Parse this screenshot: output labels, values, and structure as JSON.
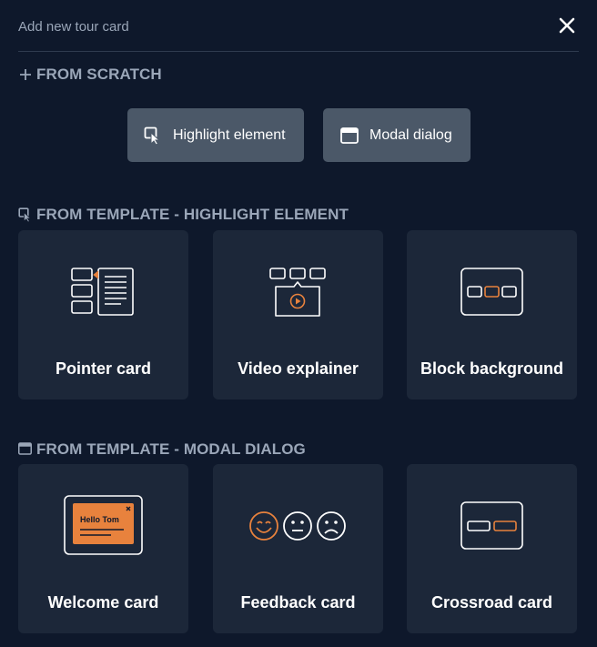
{
  "dialog": {
    "title": "Add new tour card",
    "close_icon": "close-icon"
  },
  "colors": {
    "background": "#0e182b",
    "card": "#1c2739",
    "button": "#4b5868",
    "accent": "#e8823d",
    "muted_text": "#9aa6b8"
  },
  "from_scratch": {
    "label": "FROM SCRATCH",
    "icon": "plus-icon",
    "buttons": [
      {
        "label": "Highlight element",
        "icon": "highlight-cursor-icon"
      },
      {
        "label": "Modal dialog",
        "icon": "modal-window-icon"
      }
    ]
  },
  "template_highlight": {
    "label": "FROM TEMPLATE - HIGHLIGHT ELEMENT",
    "icon": "highlight-cursor-icon",
    "cards": [
      {
        "label": "Pointer card",
        "icon": "pointer-card-illustration"
      },
      {
        "label": "Video explainer",
        "icon": "video-explainer-illustration"
      },
      {
        "label": "Block background",
        "icon": "block-background-illustration"
      }
    ]
  },
  "template_modal": {
    "label": "FROM TEMPLATE - MODAL DIALOG",
    "icon": "modal-window-icon",
    "cards": [
      {
        "label": "Welcome card",
        "icon": "welcome-card-illustration",
        "illustration_text": "Hello Tom"
      },
      {
        "label": "Feedback card",
        "icon": "feedback-faces-illustration"
      },
      {
        "label": "Crossroad card",
        "icon": "crossroad-card-illustration"
      }
    ]
  }
}
